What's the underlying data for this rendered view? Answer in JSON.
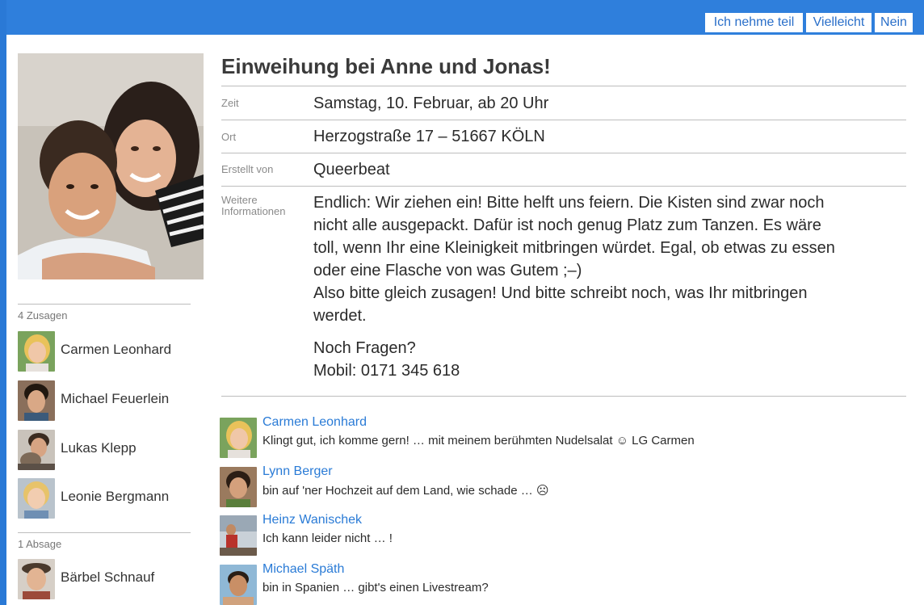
{
  "header": {
    "accent": "#2f7fdc",
    "rsvp_yes": "Ich nehme teil",
    "rsvp_maybe": "Vielleicht",
    "rsvp_no": "Nein"
  },
  "event": {
    "title": "Einweihung bei Anne und Jonas!",
    "time_label": "Zeit",
    "time_value": "Samstag, 10. Februar, ab 20 Uhr",
    "place_label": "Ort",
    "place_value": "Herzogstraße 17 – 51667 KÖLN",
    "creator_label": "Erstellt von",
    "creator_value": "Queerbeat",
    "info_label_1": "Weitere",
    "info_label_2": "Informationen",
    "info_lines": [
      "Endlich: Wir ziehen ein! Bitte helft uns feiern. Die Kisten sind zwar noch",
      "nicht alle ausgepackt. Dafür ist noch genug Platz zum Tanzen. Es wäre",
      "toll, wenn Ihr eine Kleinigkeit mitbringen würdet. Egal, ob etwas zu essen",
      "oder eine Flasche von was Gutem ;–)",
      "Also bitte gleich zusagen! Und bitte schreibt noch, was Ihr mitbringen",
      "werdet.",
      "Noch Fragen?",
      "Mobil: 0171 345 618"
    ]
  },
  "sidebar": {
    "accepted_heading": "4 Zusagen",
    "accepted": [
      {
        "name": "Carmen Leonhard"
      },
      {
        "name": "Michael Feuerlein"
      },
      {
        "name": "Lukas Klepp"
      },
      {
        "name": "Leonie Bergmann"
      }
    ],
    "declined_heading": "1 Absage",
    "declined": [
      {
        "name": "Bärbel Schnauf"
      }
    ]
  },
  "comments": [
    {
      "name": "Carmen Leonhard",
      "text": "Klingt gut, ich komme gern! … mit meinem berühmten Nudelsalat ☺ LG Carmen"
    },
    {
      "name": "Lynn Berger",
      "text": "bin auf 'ner Hochzeit auf dem Land, wie schade … ☹"
    },
    {
      "name": "Heinz Wanischek",
      "text": "Ich kann leider nicht … !"
    },
    {
      "name": "Michael Späth",
      "text": "bin in Spanien … gibt's einen Livestream?"
    }
  ]
}
